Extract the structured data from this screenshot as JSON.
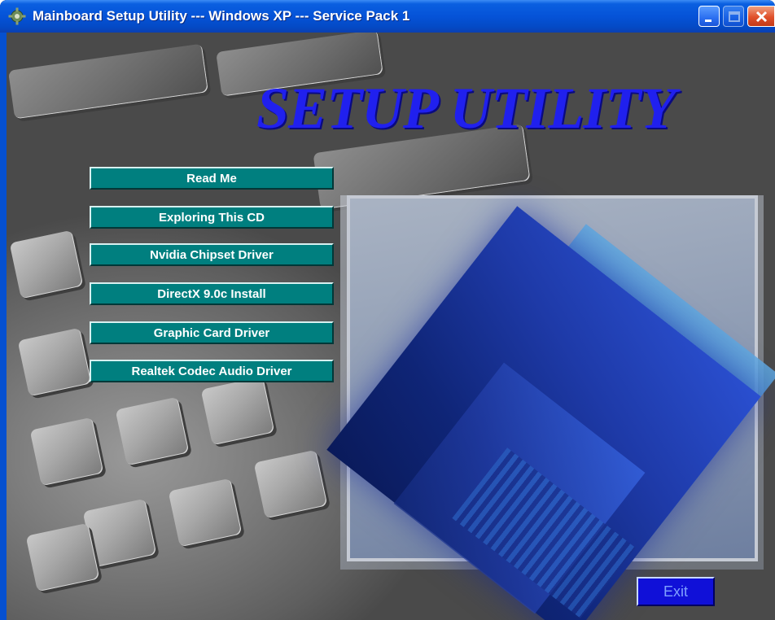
{
  "window": {
    "title": "Mainboard Setup Utility --- Windows XP --- Service Pack 1",
    "controls": [
      "minimize",
      "maximize",
      "close"
    ]
  },
  "banner": {
    "text": "SETUP UTILITY",
    "color": "#2020ee"
  },
  "menu": {
    "items": [
      {
        "label": "Read Me"
      },
      {
        "label": "Exploring This CD"
      },
      {
        "label": "Nvidia Chipset Driver"
      },
      {
        "label": "DirectX 9.0c Install"
      },
      {
        "label": "Graphic Card Driver"
      },
      {
        "label": "Realtek Codec Audio Driver"
      }
    ],
    "button_color": "#007f7f"
  },
  "exit": {
    "label": "Exit"
  },
  "icons": {
    "app": "gear-icon",
    "minimize": "minimize-icon",
    "maximize": "maximize-icon",
    "close": "close-icon"
  }
}
